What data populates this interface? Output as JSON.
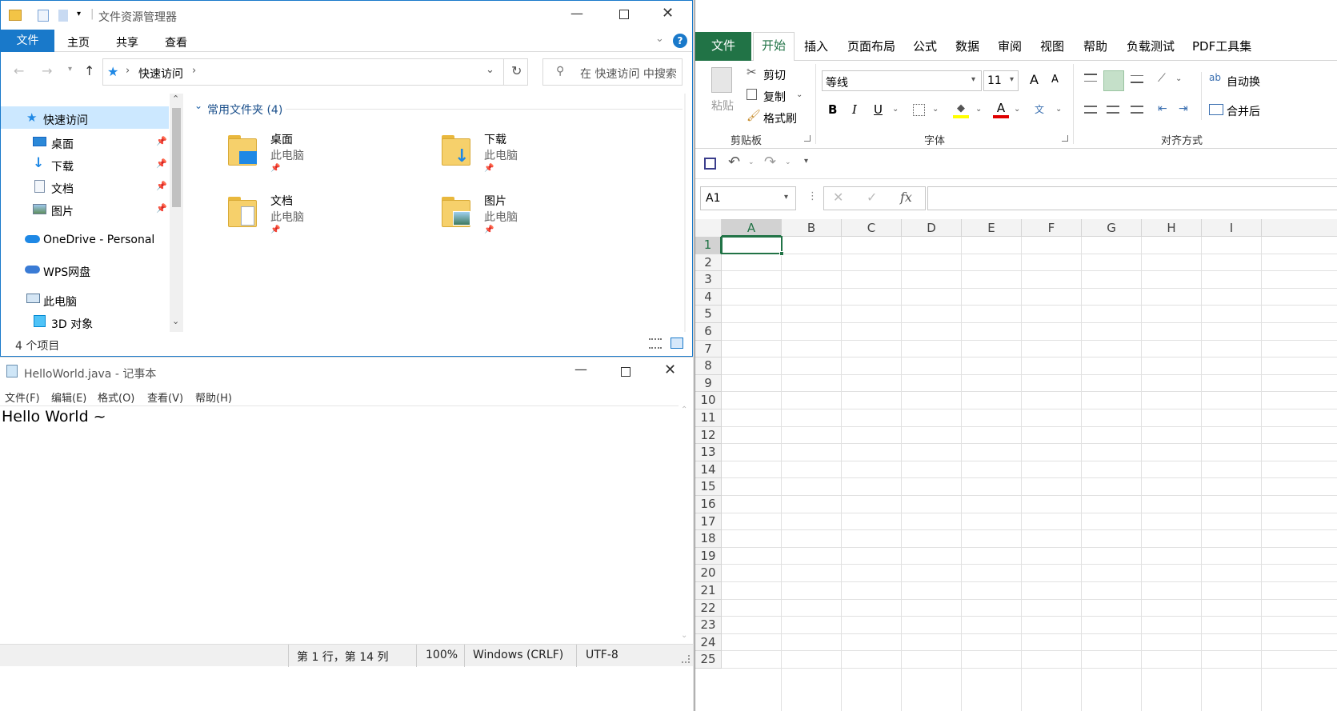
{
  "explorer": {
    "title": "文件资源管理器",
    "tabs": [
      "文件",
      "主页",
      "共享",
      "查看"
    ],
    "path_label": "快速访问",
    "search_placeholder": "在 快速访问 中搜索",
    "nav": [
      {
        "label": "快速访问",
        "icon": "star-icon"
      },
      {
        "label": "桌面",
        "icon": "desktop-icon",
        "pinned": true
      },
      {
        "label": "下载",
        "icon": "download-icon",
        "pinned": true
      },
      {
        "label": "文档",
        "icon": "document-icon",
        "pinned": true
      },
      {
        "label": "图片",
        "icon": "picture-icon",
        "pinned": true
      },
      {
        "label": "OneDrive - Personal",
        "icon": "cloud-icon"
      },
      {
        "label": "WPS网盘",
        "icon": "cloud-icon"
      },
      {
        "label": "此电脑",
        "icon": "computer-icon"
      },
      {
        "label": "3D 对象",
        "icon": "cube-icon"
      }
    ],
    "section_title": "常用文件夹 (4)",
    "folders": [
      {
        "name": "桌面",
        "location": "此电脑"
      },
      {
        "name": "下载",
        "location": "此电脑"
      },
      {
        "name": "文档",
        "location": "此电脑"
      },
      {
        "name": "图片",
        "location": "此电脑"
      }
    ],
    "status": "4 个项目"
  },
  "notepad": {
    "title": "HelloWorld.java - 记事本",
    "menu": [
      "文件(F)",
      "编辑(E)",
      "格式(O)",
      "查看(V)",
      "帮助(H)"
    ],
    "content": "Hello World ~",
    "status": {
      "position": "第 1 行，第 14 列",
      "zoom": "100%",
      "line_ending": "Windows (CRLF)",
      "encoding": "UTF-8"
    }
  },
  "excel": {
    "tabs": [
      "文件",
      "开始",
      "插入",
      "页面布局",
      "公式",
      "数据",
      "审阅",
      "视图",
      "帮助",
      "负载测试",
      "PDF工具集"
    ],
    "active_tab": "开始",
    "clipboard": {
      "paste": "粘贴",
      "cut": "剪切",
      "copy": "复制",
      "format_painter": "格式刷",
      "group": "剪贴板"
    },
    "font": {
      "name": "等线",
      "size": "11",
      "group": "字体",
      "bold": "B",
      "italic": "I",
      "underline": "U",
      "grow": "A",
      "shrink": "A"
    },
    "alignment": {
      "wrap": "自动换",
      "merge": "合并后",
      "group": "对齐方式"
    },
    "name_box": "A1",
    "fx": "fx",
    "columns": [
      "A",
      "B",
      "C",
      "D",
      "E",
      "F",
      "G",
      "H",
      "I"
    ],
    "rows": [
      "1",
      "2",
      "3",
      "4",
      "5",
      "6",
      "7",
      "8",
      "9",
      "10",
      "11",
      "12",
      "13",
      "14",
      "15",
      "16",
      "17",
      "18",
      "19",
      "20",
      "21",
      "22",
      "23",
      "24",
      "25"
    ],
    "accent": "#217346"
  }
}
